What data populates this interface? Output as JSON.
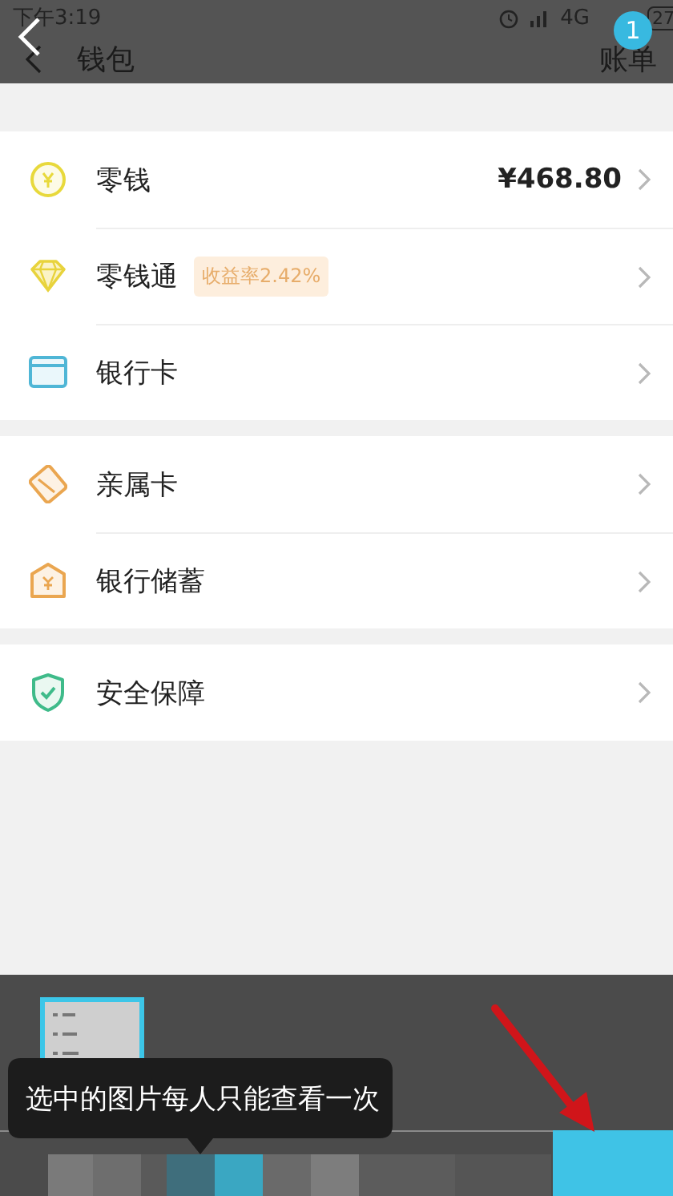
{
  "status_bar": {
    "time": "下午3:19",
    "network": "4G",
    "battery": "27"
  },
  "overlay": {
    "badge": "1"
  },
  "header": {
    "title": "钱包",
    "action": "账单"
  },
  "groups": [
    {
      "items": [
        {
          "kind": "coin",
          "label": "零钱",
          "value": "¥468.80"
        },
        {
          "kind": "diamond",
          "label": "零钱通",
          "tag": "收益率2.42%"
        },
        {
          "kind": "card",
          "label": "银行卡"
        }
      ]
    },
    {
      "items": [
        {
          "kind": "family",
          "label": "亲属卡"
        },
        {
          "kind": "bank",
          "label": "银行储蓄"
        }
      ]
    },
    {
      "items": [
        {
          "kind": "shield",
          "label": "安全保障"
        }
      ]
    }
  ],
  "tooltip": "选中的图片每人只能查看一次"
}
